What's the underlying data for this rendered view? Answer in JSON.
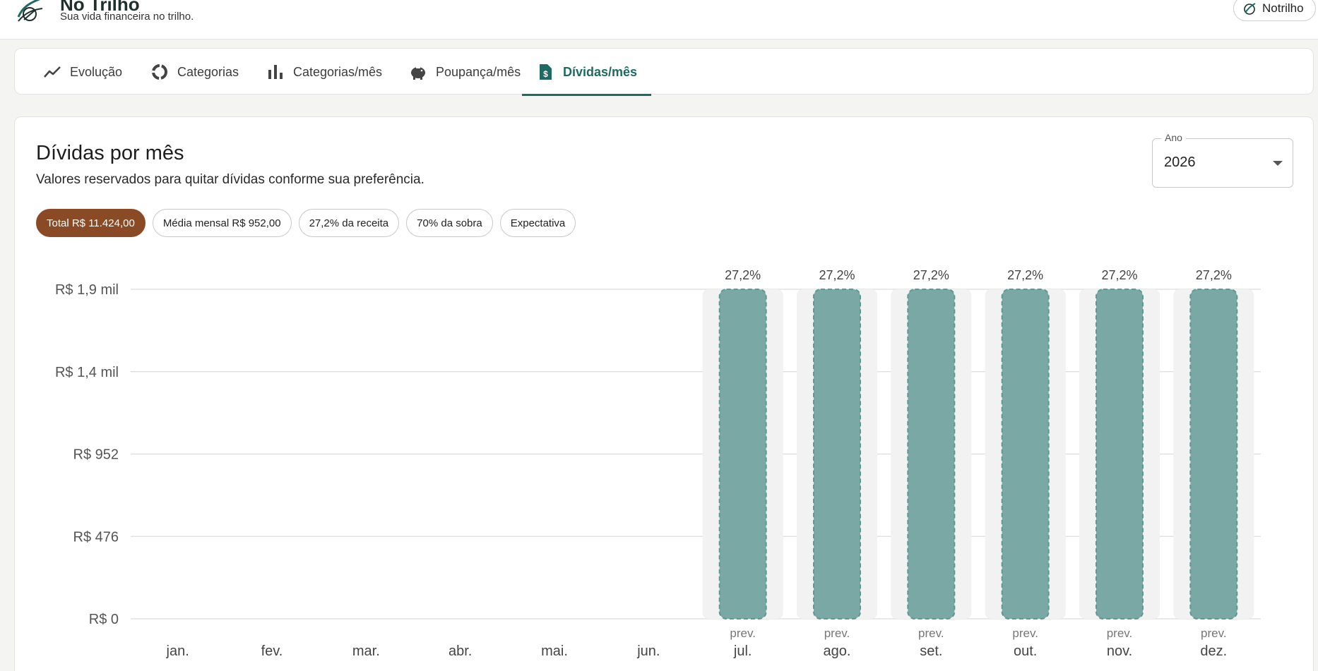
{
  "header": {
    "app_title": "No Trilho",
    "app_subtitle": "Sua vida financeira no trilho.",
    "user_label": "Notrilho"
  },
  "tabs": [
    {
      "label": "Evolução",
      "icon": "trend-line-icon",
      "active": false
    },
    {
      "label": "Categorias",
      "icon": "donut-icon",
      "active": false
    },
    {
      "label": "Categorias/mês",
      "icon": "bar-chart-icon",
      "active": false
    },
    {
      "label": "Poupança/mês",
      "icon": "piggy-bank-icon",
      "active": false
    },
    {
      "label": "Dívidas/mês",
      "icon": "money-file-icon",
      "active": true
    }
  ],
  "card": {
    "title": "Dívidas por mês",
    "subtitle": "Valores reservados para quitar dívidas conforme sua preferência."
  },
  "year_select": {
    "label": "Ano",
    "value": "2026"
  },
  "chips": [
    {
      "label": "Total R$ 11.424,00",
      "filled": true
    },
    {
      "label": "Média mensal R$ 952,00",
      "filled": false
    },
    {
      "label": "27,2% da receita",
      "filled": false
    },
    {
      "label": "70% da sobra",
      "filled": false
    },
    {
      "label": "Expectativa",
      "filled": false
    }
  ],
  "colors": {
    "accent": "#1f6b62",
    "bar": "#7aa8a4",
    "bar_border": "#5f9792",
    "chip_filled": "#8a4a25",
    "bar_track": "#f2f2f2"
  },
  "chart_data": {
    "type": "bar",
    "categories": [
      "jan.",
      "fev.",
      "mar.",
      "abr.",
      "mai.",
      "jun.",
      "jul.",
      "ago.",
      "set.",
      "out.",
      "nov.",
      "dez."
    ],
    "values": [
      0,
      0,
      0,
      0,
      0,
      0,
      1904,
      1904,
      1904,
      1904,
      1904,
      1904
    ],
    "top_labels": [
      "",
      "",
      "",
      "",
      "",
      "",
      "27,2%",
      "27,2%",
      "27,2%",
      "27,2%",
      "27,2%",
      "27,2%"
    ],
    "bottom_labels": [
      "",
      "",
      "",
      "",
      "",
      "",
      "prev.",
      "prev.",
      "prev.",
      "prev.",
      "prev.",
      "prev."
    ],
    "y_ticks": [
      0,
      476,
      952,
      1428,
      1904
    ],
    "y_tick_labels": [
      "R$ 0",
      "R$ 476",
      "R$ 952",
      "R$ 1,4 mil",
      "R$ 1,9 mil"
    ],
    "ylim": [
      0,
      1904
    ],
    "grid": true,
    "title": "",
    "xlabel": "",
    "ylabel": ""
  }
}
